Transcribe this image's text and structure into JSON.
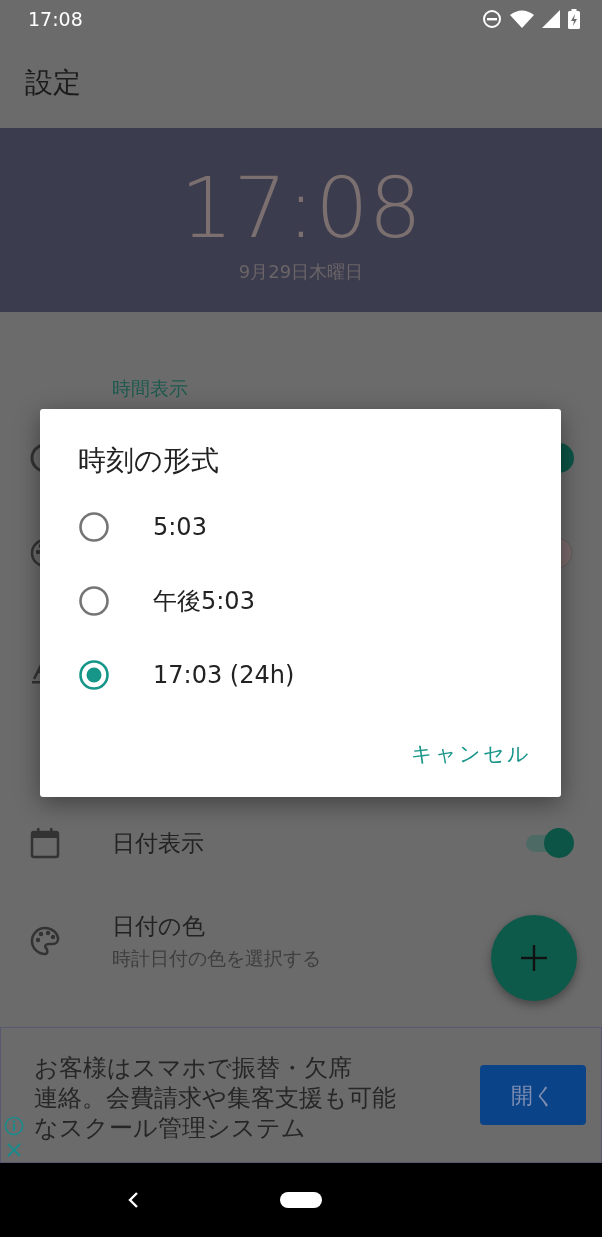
{
  "status_bar": {
    "time": "17:08"
  },
  "app_bar": {
    "title": "設定"
  },
  "clock_preview": {
    "time": "17:08",
    "date": "9月29日木曜日"
  },
  "settings": {
    "section": "時間表示",
    "rows": [
      {
        "kind": "switch",
        "on": true
      },
      {
        "kind": "color"
      },
      {
        "kind": "plain"
      },
      {
        "kind": "switch",
        "title": "日付表示",
        "on": true
      },
      {
        "kind": "color",
        "title": "日付の色",
        "subtitle": "時計日付の色を選択する"
      }
    ]
  },
  "dialog": {
    "title": "時刻の形式",
    "options": [
      {
        "label": "5:03",
        "selected": false
      },
      {
        "label": "午後5:03",
        "selected": false
      },
      {
        "label": "17:03 (24h)",
        "selected": true
      }
    ],
    "cancel": "キャンセル"
  },
  "ad": {
    "lines": [
      "お客様はスマホで振替・欠席",
      "連絡。会費請求や集客支援も可能",
      "なスクール管理システム"
    ],
    "button": "開く"
  }
}
